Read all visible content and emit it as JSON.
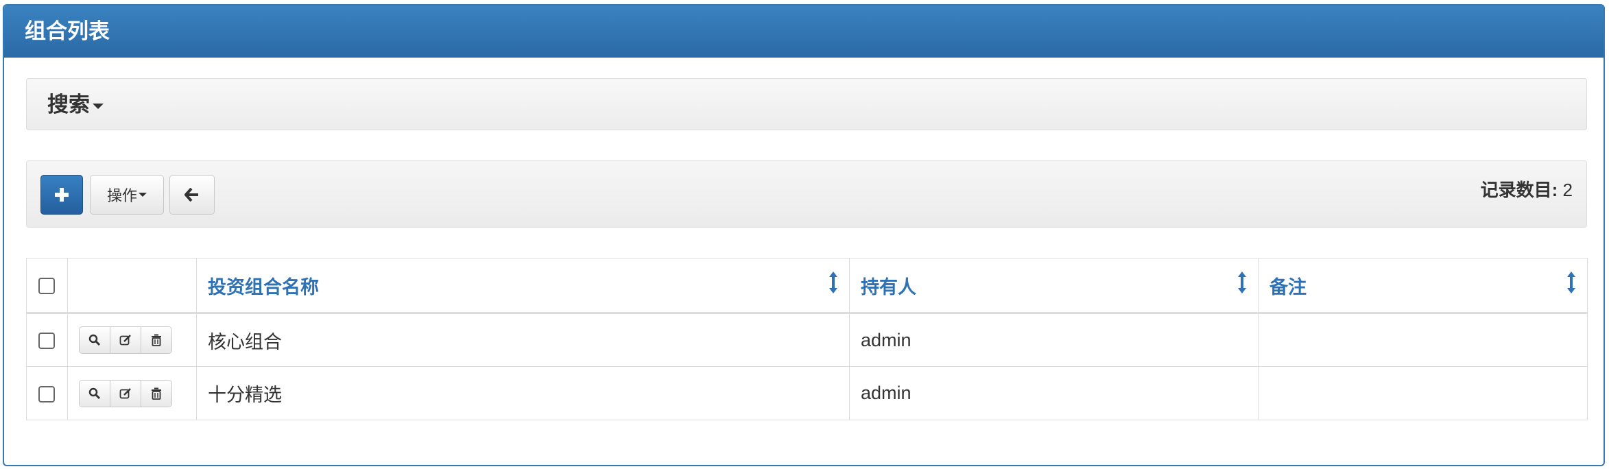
{
  "panel": {
    "title": "组合列表"
  },
  "search": {
    "label": "搜索"
  },
  "toolbar": {
    "add_icon": "plus-icon",
    "ops_label": "操作",
    "back_icon": "arrow-left-icon",
    "record_count_label": "记录数目:",
    "record_count_value": "2"
  },
  "table": {
    "columns": [
      "投资组合名称",
      "持有人",
      "备注"
    ],
    "row_actions": [
      "search-icon",
      "edit-icon",
      "trash-icon"
    ],
    "rows": [
      {
        "name": "核心组合",
        "owner": "admin",
        "note": ""
      },
      {
        "name": "十分精选",
        "owner": "admin",
        "note": ""
      }
    ]
  },
  "colors": {
    "header": "#2f74b2",
    "link": "#2e72b5",
    "primary_button": "#2e6fb0"
  }
}
